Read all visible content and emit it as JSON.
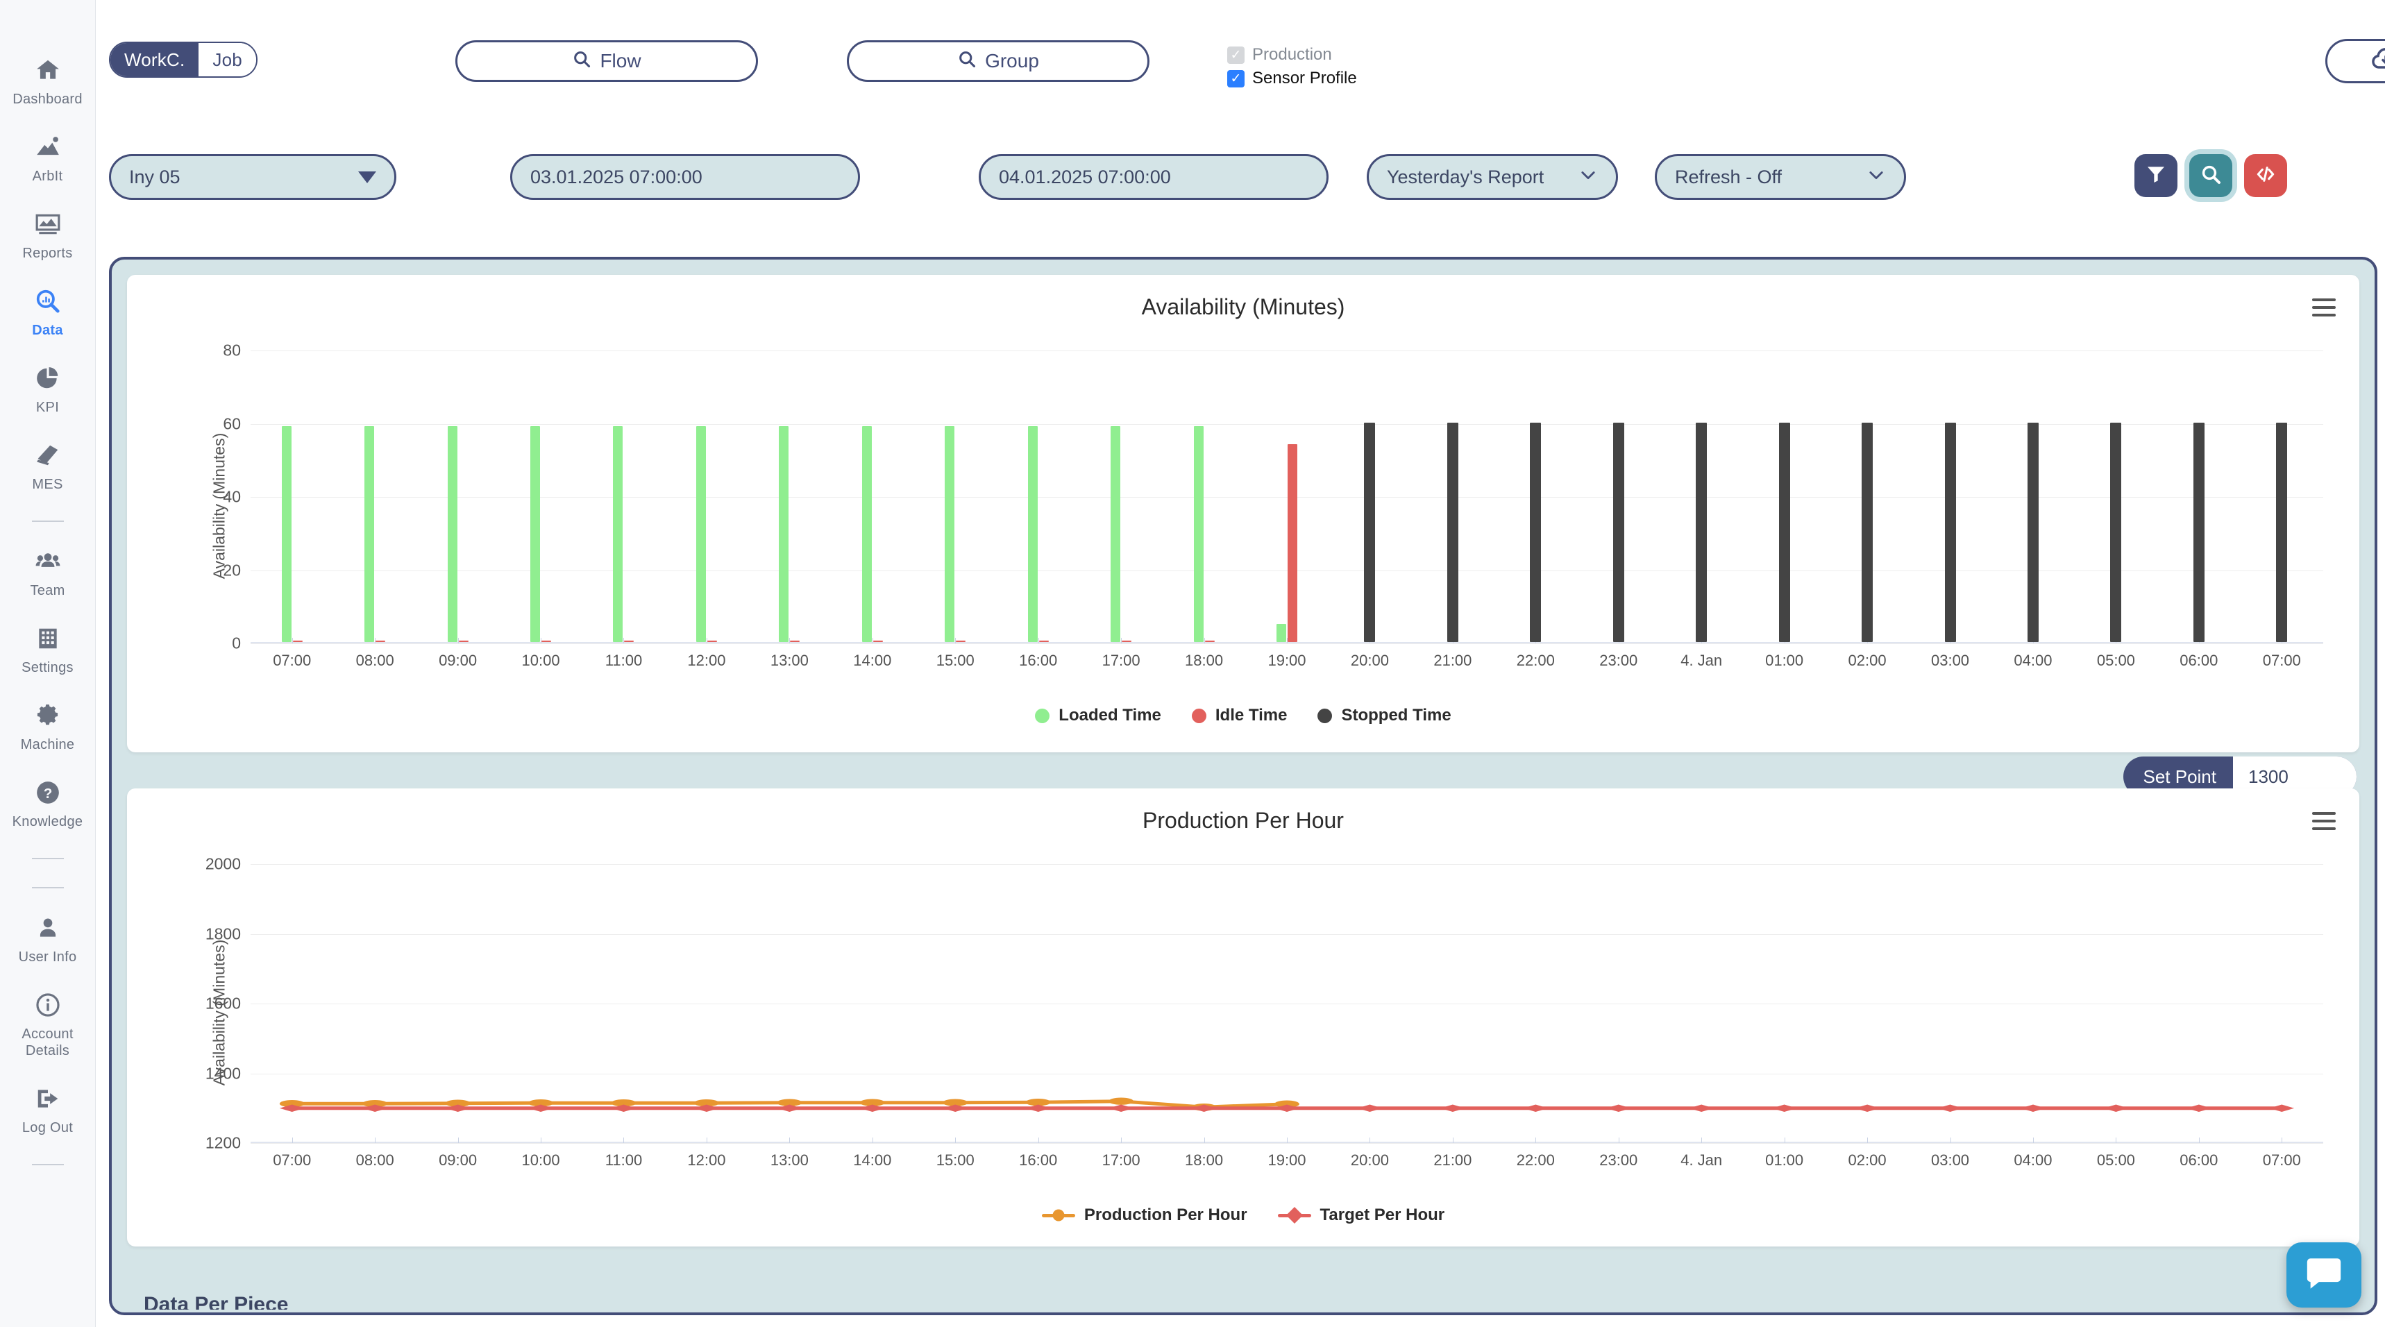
{
  "sidebar": {
    "items": [
      {
        "label": "Dashboard",
        "icon": "home-icon",
        "active": false
      },
      {
        "label": "ArbIt",
        "icon": "trend-icon",
        "active": false
      },
      {
        "label": "Reports",
        "icon": "report-icon",
        "active": false
      },
      {
        "label": "Data",
        "icon": "search-data-icon",
        "active": true
      },
      {
        "label": "KPI",
        "icon": "pie-chart-icon",
        "active": false
      },
      {
        "label": "MES",
        "icon": "clipboard-icon",
        "active": false
      },
      {
        "label": "Team",
        "icon": "team-icon",
        "active": false
      },
      {
        "label": "Settings",
        "icon": "building-icon",
        "active": false
      },
      {
        "label": "Machine",
        "icon": "gear-icon",
        "active": false
      },
      {
        "label": "Knowledge",
        "icon": "question-icon",
        "active": false
      },
      {
        "label": "User Info",
        "icon": "user-icon",
        "active": false
      },
      {
        "label": "Account Details",
        "icon": "info-icon",
        "active": false
      },
      {
        "label": "Log Out",
        "icon": "logout-icon",
        "active": false
      }
    ]
  },
  "topbar": {
    "segment": {
      "left_label": "WorkC.",
      "right_label": "Job",
      "selected": "WorkC."
    },
    "flow_button": "Flow",
    "group_button": "Group",
    "checkboxes": [
      {
        "label": "Production",
        "checked": true,
        "disabled": true
      },
      {
        "label": "Sensor Profile",
        "checked": true,
        "disabled": false
      }
    ],
    "cloud_button_icon": "cloud-download-icon"
  },
  "filters": {
    "machine": "Iny 05",
    "arrow_icon": "arrow-right-icon",
    "date_from": "03.01.2025 07:00:00",
    "date_to": "04.01.2025 07:00:00",
    "report": "Yesterday's Report",
    "refresh": "Refresh - Off",
    "buttons": [
      {
        "name": "filter-button",
        "icon": "funnel-icon",
        "color": "#434d78"
      },
      {
        "name": "search-button",
        "icon": "magnifier-icon",
        "color": "#3d8a95"
      },
      {
        "name": "code-button",
        "icon": "code-icon",
        "color": "#d9524f"
      }
    ]
  },
  "setpoint": {
    "label": "Set Point",
    "value": "1300"
  },
  "cut_off_title": "Data Per Piece",
  "chat": {
    "icon": "chat-icon"
  },
  "chart_data": [
    {
      "type": "bar",
      "title": "Availability (Minutes)",
      "xlabel": "",
      "ylabel": "Availability (Minutes)",
      "ylim": [
        0,
        80
      ],
      "yticks": [
        0,
        20,
        40,
        60,
        80
      ],
      "grid": true,
      "legend_position": "bottom",
      "menu_icon": "hamburger-menu-icon",
      "categories": [
        "07:00",
        "08:00",
        "09:00",
        "10:00",
        "11:00",
        "12:00",
        "13:00",
        "14:00",
        "15:00",
        "16:00",
        "17:00",
        "18:00",
        "19:00",
        "20:00",
        "21:00",
        "22:00",
        "23:00",
        "4. Jan",
        "01:00",
        "02:00",
        "03:00",
        "04:00",
        "05:00",
        "06:00",
        "07:00"
      ],
      "series": [
        {
          "name": "Loaded Time",
          "color": "#90ee90",
          "values": [
            59,
            59,
            59,
            59,
            59,
            59,
            59,
            59,
            59,
            59,
            59,
            59,
            5,
            0,
            0,
            0,
            0,
            0,
            0,
            0,
            0,
            0,
            0,
            0,
            0
          ]
        },
        {
          "name": "Idle Time",
          "color": "#e2605c",
          "values": [
            0.4,
            0.4,
            0.4,
            0.4,
            0.4,
            0.4,
            0.4,
            0.4,
            0.4,
            0.4,
            0.4,
            0.4,
            54,
            0,
            0,
            0,
            0,
            0,
            0,
            0,
            0,
            0,
            0,
            0,
            0
          ]
        },
        {
          "name": "Stopped Time",
          "color": "#444444",
          "values": [
            0,
            0,
            0,
            0,
            0,
            0,
            0,
            0,
            0,
            0,
            0,
            0,
            0,
            60,
            60,
            60,
            60,
            60,
            60,
            60,
            60,
            60,
            60,
            60,
            60
          ]
        }
      ]
    },
    {
      "type": "line",
      "title": "Production Per Hour",
      "xlabel": "",
      "ylabel": "Availability (Minutes)",
      "ylim": [
        1200,
        2000
      ],
      "yticks": [
        1200,
        1400,
        1600,
        1800,
        2000
      ],
      "grid": true,
      "legend_position": "bottom",
      "menu_icon": "hamburger-menu-icon",
      "x": [
        "07:00",
        "08:00",
        "09:00",
        "10:00",
        "11:00",
        "12:00",
        "13:00",
        "14:00",
        "15:00",
        "16:00",
        "17:00",
        "18:00",
        "19:00",
        "20:00",
        "21:00",
        "22:00",
        "23:00",
        "4. Jan",
        "01:00",
        "02:00",
        "03:00",
        "04:00",
        "05:00",
        "06:00",
        "07:00"
      ],
      "series": [
        {
          "name": "Production Per Hour",
          "color": "#e8962f",
          "marker": "circle",
          "values": [
            1313,
            1313,
            1314,
            1315,
            1315,
            1315,
            1316,
            1316,
            1316,
            1317,
            1320,
            1303,
            1312,
            null,
            null,
            null,
            null,
            null,
            null,
            null,
            null,
            null,
            null,
            null,
            null
          ]
        },
        {
          "name": "Target Per Hour",
          "color": "#e2605c",
          "marker": "diamond",
          "values": [
            1300,
            1300,
            1300,
            1300,
            1300,
            1300,
            1300,
            1300,
            1300,
            1300,
            1300,
            1300,
            1300,
            1300,
            1300,
            1300,
            1300,
            1300,
            1300,
            1300,
            1300,
            1300,
            1300,
            1300,
            1300
          ]
        }
      ]
    }
  ]
}
